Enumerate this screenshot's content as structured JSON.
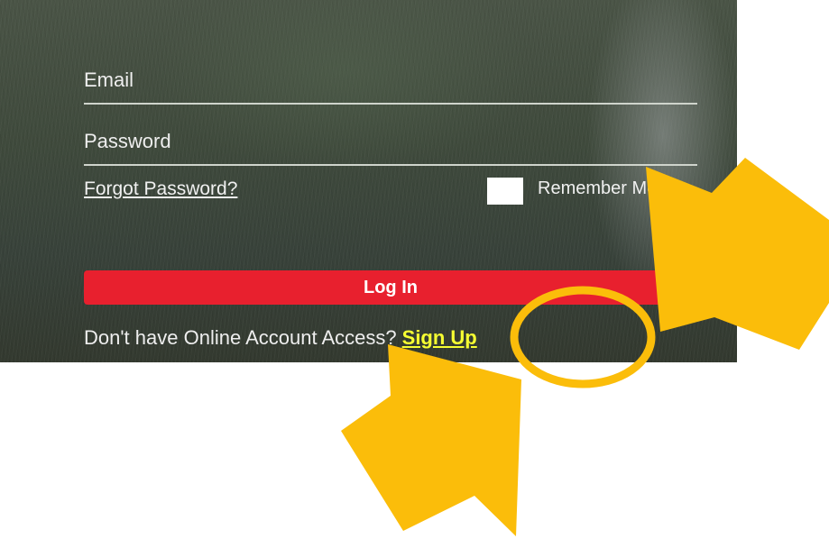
{
  "login_form": {
    "email_placeholder": "Email",
    "password_placeholder": "Password",
    "forgot_password": "Forgot Password?",
    "remember_me": "Remember Me",
    "login_button": "Log In",
    "signup_prompt": "Don't have Online Account Access?",
    "signup_link": "Sign Up"
  },
  "colors": {
    "login_button": "#e8202e",
    "signup_link": "#f6ff32",
    "annotation": "#fbbd0a"
  },
  "annotations": {
    "icons": [
      "arrow-icon",
      "arrow-icon",
      "highlight-circle-icon"
    ]
  }
}
